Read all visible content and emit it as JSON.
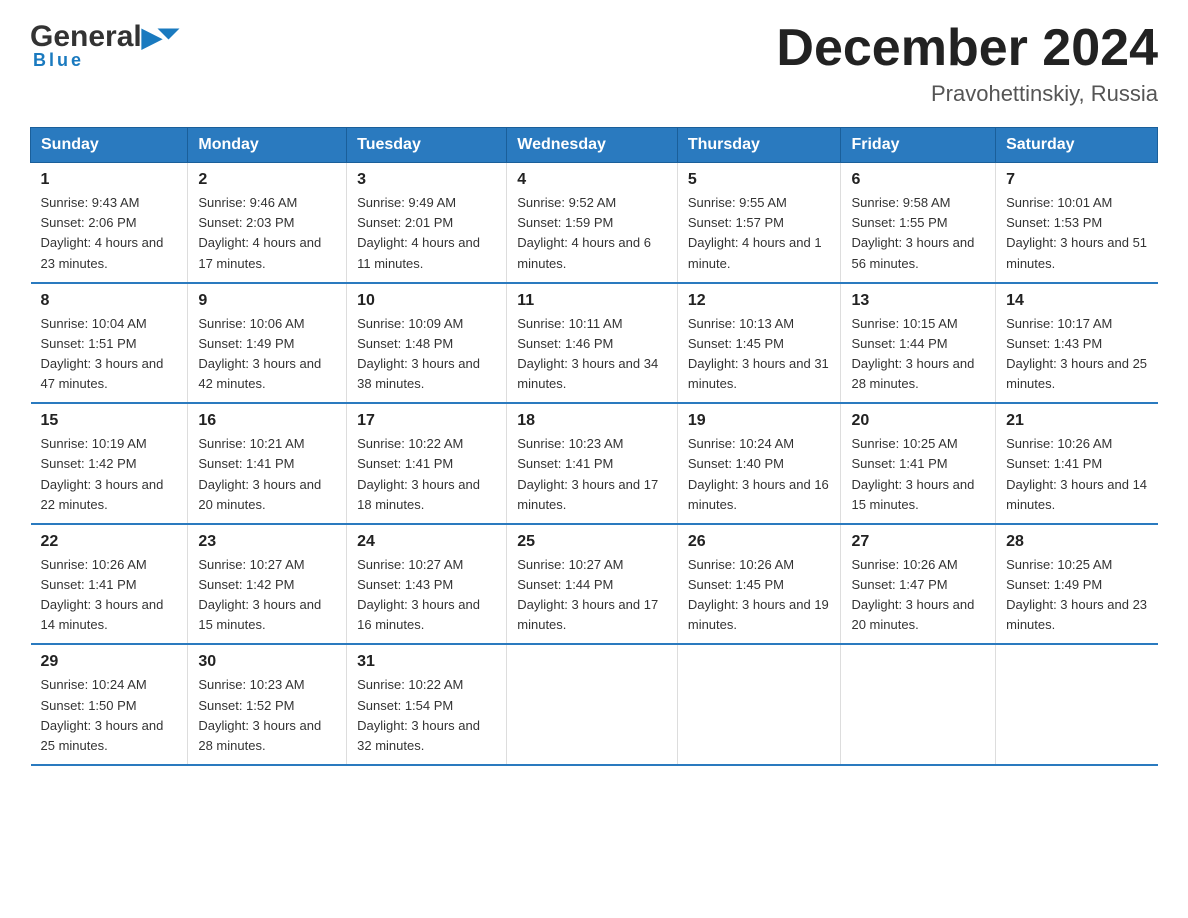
{
  "header": {
    "logo_general": "General",
    "logo_blue": "Blue",
    "month_title": "December 2024",
    "location": "Pravohettinskiy, Russia"
  },
  "weekdays": [
    "Sunday",
    "Monday",
    "Tuesday",
    "Wednesday",
    "Thursday",
    "Friday",
    "Saturday"
  ],
  "weeks": [
    [
      {
        "day": "1",
        "sunrise": "9:43 AM",
        "sunset": "2:06 PM",
        "daylight": "4 hours and 23 minutes."
      },
      {
        "day": "2",
        "sunrise": "9:46 AM",
        "sunset": "2:03 PM",
        "daylight": "4 hours and 17 minutes."
      },
      {
        "day": "3",
        "sunrise": "9:49 AM",
        "sunset": "2:01 PM",
        "daylight": "4 hours and 11 minutes."
      },
      {
        "day": "4",
        "sunrise": "9:52 AM",
        "sunset": "1:59 PM",
        "daylight": "4 hours and 6 minutes."
      },
      {
        "day": "5",
        "sunrise": "9:55 AM",
        "sunset": "1:57 PM",
        "daylight": "4 hours and 1 minute."
      },
      {
        "day": "6",
        "sunrise": "9:58 AM",
        "sunset": "1:55 PM",
        "daylight": "3 hours and 56 minutes."
      },
      {
        "day": "7",
        "sunrise": "10:01 AM",
        "sunset": "1:53 PM",
        "daylight": "3 hours and 51 minutes."
      }
    ],
    [
      {
        "day": "8",
        "sunrise": "10:04 AM",
        "sunset": "1:51 PM",
        "daylight": "3 hours and 47 minutes."
      },
      {
        "day": "9",
        "sunrise": "10:06 AM",
        "sunset": "1:49 PM",
        "daylight": "3 hours and 42 minutes."
      },
      {
        "day": "10",
        "sunrise": "10:09 AM",
        "sunset": "1:48 PM",
        "daylight": "3 hours and 38 minutes."
      },
      {
        "day": "11",
        "sunrise": "10:11 AM",
        "sunset": "1:46 PM",
        "daylight": "3 hours and 34 minutes."
      },
      {
        "day": "12",
        "sunrise": "10:13 AM",
        "sunset": "1:45 PM",
        "daylight": "3 hours and 31 minutes."
      },
      {
        "day": "13",
        "sunrise": "10:15 AM",
        "sunset": "1:44 PM",
        "daylight": "3 hours and 28 minutes."
      },
      {
        "day": "14",
        "sunrise": "10:17 AM",
        "sunset": "1:43 PM",
        "daylight": "3 hours and 25 minutes."
      }
    ],
    [
      {
        "day": "15",
        "sunrise": "10:19 AM",
        "sunset": "1:42 PM",
        "daylight": "3 hours and 22 minutes."
      },
      {
        "day": "16",
        "sunrise": "10:21 AM",
        "sunset": "1:41 PM",
        "daylight": "3 hours and 20 minutes."
      },
      {
        "day": "17",
        "sunrise": "10:22 AM",
        "sunset": "1:41 PM",
        "daylight": "3 hours and 18 minutes."
      },
      {
        "day": "18",
        "sunrise": "10:23 AM",
        "sunset": "1:41 PM",
        "daylight": "3 hours and 17 minutes."
      },
      {
        "day": "19",
        "sunrise": "10:24 AM",
        "sunset": "1:40 PM",
        "daylight": "3 hours and 16 minutes."
      },
      {
        "day": "20",
        "sunrise": "10:25 AM",
        "sunset": "1:41 PM",
        "daylight": "3 hours and 15 minutes."
      },
      {
        "day": "21",
        "sunrise": "10:26 AM",
        "sunset": "1:41 PM",
        "daylight": "3 hours and 14 minutes."
      }
    ],
    [
      {
        "day": "22",
        "sunrise": "10:26 AM",
        "sunset": "1:41 PM",
        "daylight": "3 hours and 14 minutes."
      },
      {
        "day": "23",
        "sunrise": "10:27 AM",
        "sunset": "1:42 PM",
        "daylight": "3 hours and 15 minutes."
      },
      {
        "day": "24",
        "sunrise": "10:27 AM",
        "sunset": "1:43 PM",
        "daylight": "3 hours and 16 minutes."
      },
      {
        "day": "25",
        "sunrise": "10:27 AM",
        "sunset": "1:44 PM",
        "daylight": "3 hours and 17 minutes."
      },
      {
        "day": "26",
        "sunrise": "10:26 AM",
        "sunset": "1:45 PM",
        "daylight": "3 hours and 19 minutes."
      },
      {
        "day": "27",
        "sunrise": "10:26 AM",
        "sunset": "1:47 PM",
        "daylight": "3 hours and 20 minutes."
      },
      {
        "day": "28",
        "sunrise": "10:25 AM",
        "sunset": "1:49 PM",
        "daylight": "3 hours and 23 minutes."
      }
    ],
    [
      {
        "day": "29",
        "sunrise": "10:24 AM",
        "sunset": "1:50 PM",
        "daylight": "3 hours and 25 minutes."
      },
      {
        "day": "30",
        "sunrise": "10:23 AM",
        "sunset": "1:52 PM",
        "daylight": "3 hours and 28 minutes."
      },
      {
        "day": "31",
        "sunrise": "10:22 AM",
        "sunset": "1:54 PM",
        "daylight": "3 hours and 32 minutes."
      },
      null,
      null,
      null,
      null
    ]
  ],
  "labels": {
    "sunrise": "Sunrise:",
    "sunset": "Sunset:",
    "daylight": "Daylight:"
  }
}
